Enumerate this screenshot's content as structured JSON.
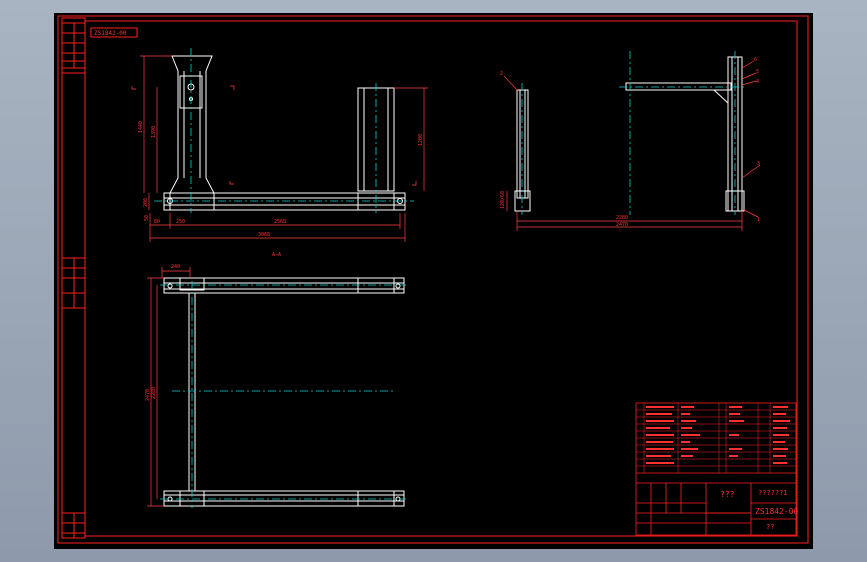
{
  "app": {
    "background": "#9aa6b6"
  },
  "drawing": {
    "colors": {
      "border": "#ff2020",
      "line": "#ffffff",
      "center": "#00d0d0",
      "dim": "#ff4040",
      "text": "#ff3030"
    },
    "code_box": "ZS1842-00",
    "views": {
      "front": {
        "dims": {
          "overall_width": "3068",
          "inner_span": "2568",
          "left_offset": "250",
          "height_total": "1440",
          "height_inner": "1390",
          "right_height": "1200",
          "base_h": "200",
          "base_side": "80",
          "small": "50"
        }
      },
      "side": {
        "dims": {
          "width_inner": "2280",
          "width_total": "2470",
          "base_label": "120/60"
        },
        "leaders": [
          "1",
          "2",
          "3",
          "4",
          "5",
          "6"
        ]
      },
      "plan": {
        "section_label": "A—A",
        "dims": {
          "top_width": "240",
          "height_outer": "2470",
          "height_inner": "2280"
        }
      }
    },
    "title_block": {
      "designation": "???",
      "name": "??????1",
      "drawing_no": "ZS1842-00",
      "material": "??"
    },
    "side_stamps": {
      "top": "??",
      "bottom": "??"
    }
  }
}
